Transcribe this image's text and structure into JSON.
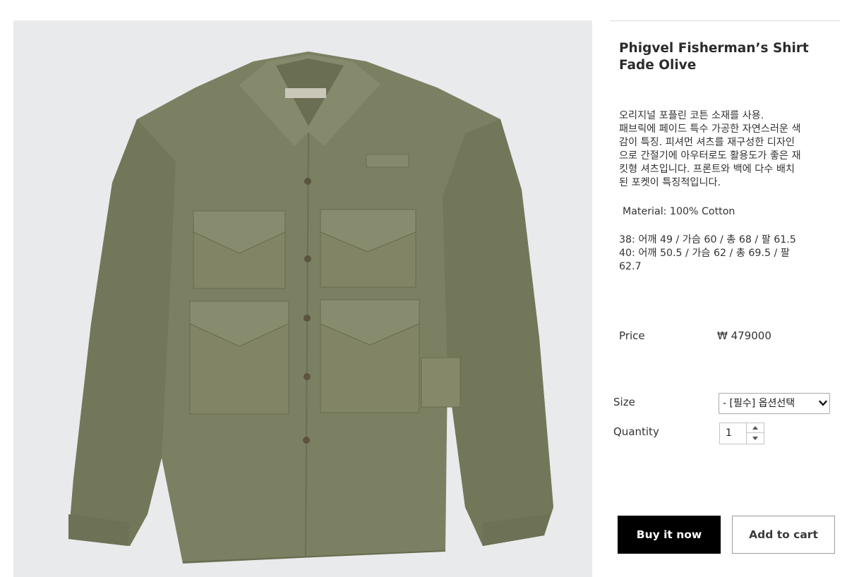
{
  "product": {
    "title_line1": "Phigvel Fisherman’s Shirt",
    "title_line2": "Fade Olive",
    "description_lines": [
      "오리지널 포플린 코튼 소재를 사용.",
      "패브릭에 페이드 특수 가공한 자연스러운 색",
      "감이 특징. 피셔먼 셔츠를 재구성한 디자인",
      "으로 간절기에 아우터로도 활용도가 좋은 재",
      "킷형 셔츠입니다. 프론트와 백에 다수 배치",
      "된 포켓이 특징적입니다."
    ],
    "material": "Material: 100% Cotton",
    "size_lines": [
      "38: 어깨 49 / 가슴 60 / 총 68 / 팔 61.5",
      "40: 어깨 50.5 / 가슴 62 / 총 69.5 / 팔",
      "62.7"
    ],
    "image_icon": "olive-shirt-photo"
  },
  "price": {
    "label": "Price",
    "value": "₩ 479000"
  },
  "options": {
    "size_label": "Size",
    "size_selected": "- [필수] 옵션선택",
    "quantity_label": "Quantity",
    "quantity_value": "1"
  },
  "actions": {
    "buy_label": "Buy it now",
    "cart_label": "Add to cart"
  },
  "colors": {
    "shirt": "#7c8063",
    "background": "#e9eaeb",
    "buy_bg": "#000000"
  }
}
